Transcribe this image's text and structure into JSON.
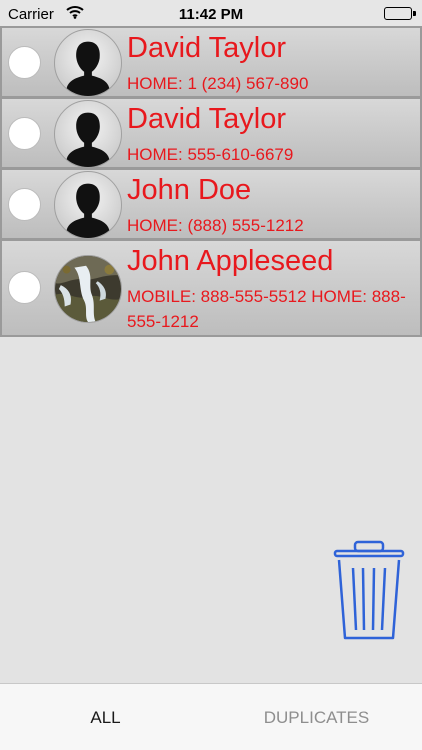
{
  "status_bar": {
    "carrier": "Carrier",
    "time": "11:42 PM",
    "battery_level": 1.0
  },
  "contacts": [
    {
      "name": "David Taylor",
      "phone": "HOME: 1 (234) 567-890",
      "avatar": "silhouette-icon",
      "selected": false
    },
    {
      "name": "David Taylor",
      "phone": "HOME: 555-610-6679",
      "avatar": "silhouette-icon",
      "selected": false
    },
    {
      "name": "John Doe",
      "phone": "HOME: (888) 555-1212",
      "avatar": "silhouette-icon",
      "selected": false
    },
    {
      "name": "John Appleseed",
      "phone": "MOBILE: 888-555-5512 HOME: 888-555-1212",
      "avatar": "waterfall-photo",
      "selected": false
    }
  ],
  "trash": {
    "icon": "trash-icon",
    "color": "#2f63d8"
  },
  "tabs": [
    {
      "label": "ALL",
      "active": true
    },
    {
      "label": "DUPLICATES",
      "active": false
    }
  ],
  "colors": {
    "contact_text": "#e8181d",
    "accent": "#2f63d8"
  }
}
